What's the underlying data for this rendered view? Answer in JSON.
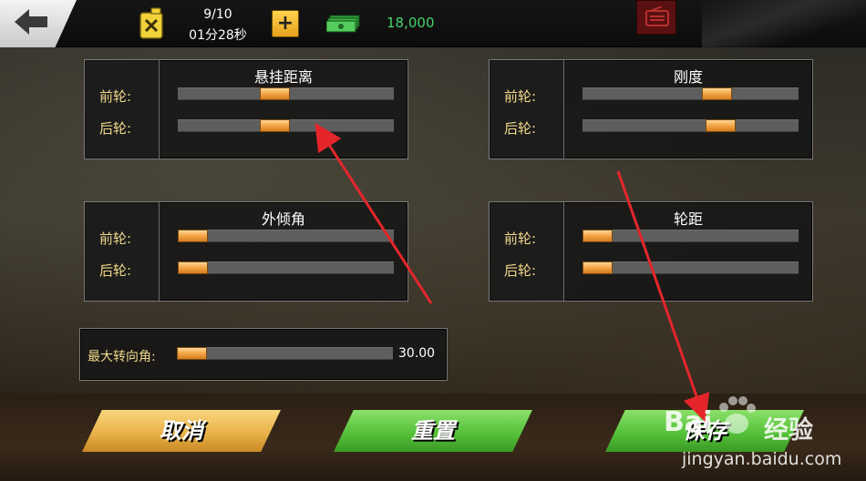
{
  "colors": {
    "accent_orange": "#f5a84a",
    "cash_green": "#46d36b",
    "label_yellow": "#f1d98a",
    "arrow_red": "#e4262b"
  },
  "topbar": {
    "back_icon": "arrow-left-icon",
    "fuel_icon": "fuel-can-icon",
    "fuel_count": "9/10",
    "fuel_timer": "01分28秒",
    "add_label": "+",
    "cash_icon": "cash-stack-icon",
    "cash_amount": "18,000",
    "shop_icon": "radio-icon"
  },
  "panels": {
    "suspension": {
      "title": "悬挂距离",
      "front_label": "前轮:",
      "rear_label": "后轮:",
      "front_value": 0.44,
      "rear_value": 0.44
    },
    "stiffness": {
      "title": "刚度",
      "front_label": "前轮:",
      "rear_label": "后轮:",
      "front_value": 0.64,
      "rear_value": 0.66
    },
    "camber": {
      "title": "外倾角",
      "front_label": "前轮:",
      "rear_label": "后轮:",
      "front_value": 0.0,
      "rear_value": 0.0
    },
    "track_width": {
      "title": "轮距",
      "front_label": "前轮:",
      "rear_label": "后轮:",
      "front_value": 0.0,
      "rear_value": 0.0
    }
  },
  "steering": {
    "label": "最大转向角:",
    "value_text": "30.00",
    "value": 0.0
  },
  "buttons": {
    "cancel": "取消",
    "reset": "重置",
    "save": "保存"
  },
  "watermark": {
    "brand": "Bai",
    "brand_cn": "经验",
    "url": "jingyan.baidu.com"
  }
}
